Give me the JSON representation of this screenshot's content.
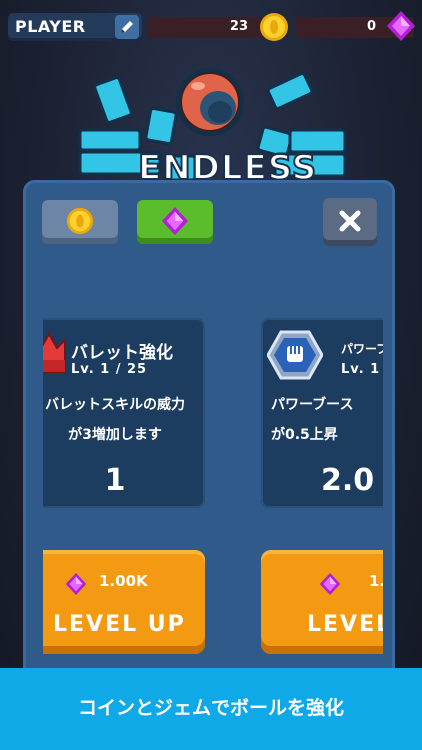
{
  "header": {
    "player_name": "PLAYER",
    "coins": "23",
    "gems": "0"
  },
  "logo": {
    "text": "ENDLESS"
  },
  "cards": [
    {
      "title": "バレット強化",
      "level": "Lv.  1  / 25",
      "description": "バレットスキルの威力\nが3増加します",
      "value": "1",
      "cost": "1.00K",
      "button": "LEVEL UP"
    },
    {
      "title": "パワーブ",
      "level": "Lv.  1",
      "description": "パワーブース\nが0.5上昇",
      "value": "2.0",
      "cost": "1.",
      "button": "LEVEL"
    }
  ],
  "banner": {
    "text": "コインとジェムでボールを強化"
  },
  "colors": {
    "accent_orange": "#f39a12",
    "accent_green": "#5bbd2b",
    "banner_blue": "#10a9e8"
  }
}
